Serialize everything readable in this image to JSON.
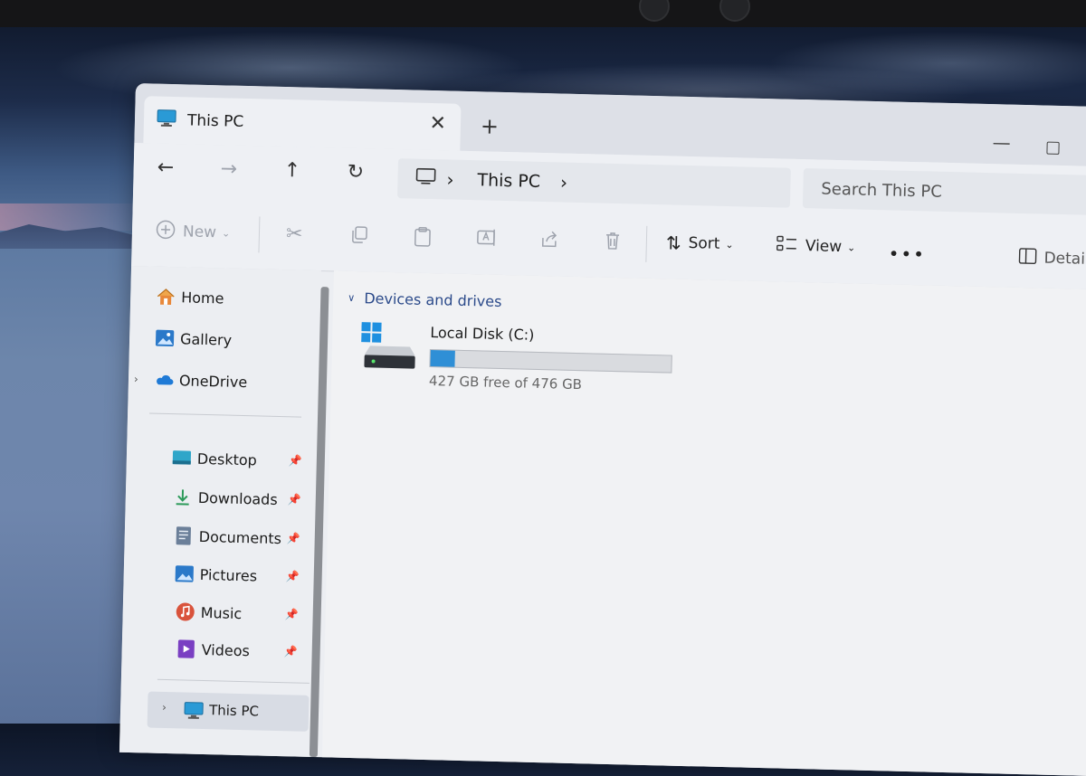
{
  "window": {
    "tab_title": "This PC",
    "new_tab_symbol": "+"
  },
  "navigation": {
    "breadcrumb": [
      "This PC"
    ],
    "search_placeholder": "Search This PC"
  },
  "toolbar": {
    "new_label": "New",
    "sort_label": "Sort",
    "view_label": "View",
    "more_label": "•••",
    "details_label": "Details"
  },
  "sidebar": {
    "top_items": [
      {
        "label": "Home",
        "icon": "home-icon"
      },
      {
        "label": "Gallery",
        "icon": "gallery-icon"
      },
      {
        "label": "OneDrive",
        "icon": "onedrive-icon"
      }
    ],
    "pinned_items": [
      {
        "label": "Desktop",
        "icon": "desktop-icon"
      },
      {
        "label": "Downloads",
        "icon": "downloads-icon"
      },
      {
        "label": "Documents",
        "icon": "documents-icon"
      },
      {
        "label": "Pictures",
        "icon": "pictures-icon"
      },
      {
        "label": "Music",
        "icon": "music-icon"
      },
      {
        "label": "Videos",
        "icon": "videos-icon"
      }
    ],
    "bottom_item": {
      "label": "This PC",
      "icon": "pc-icon"
    }
  },
  "content": {
    "section_title": "Devices and drives",
    "drives": [
      {
        "name": "Local Disk (C:)",
        "free_text": "427 GB free of 476 GB",
        "used_fraction": 0.103
      }
    ]
  },
  "colors": {
    "accent": "#2f8fd6",
    "section_text": "#2b4a8a"
  }
}
